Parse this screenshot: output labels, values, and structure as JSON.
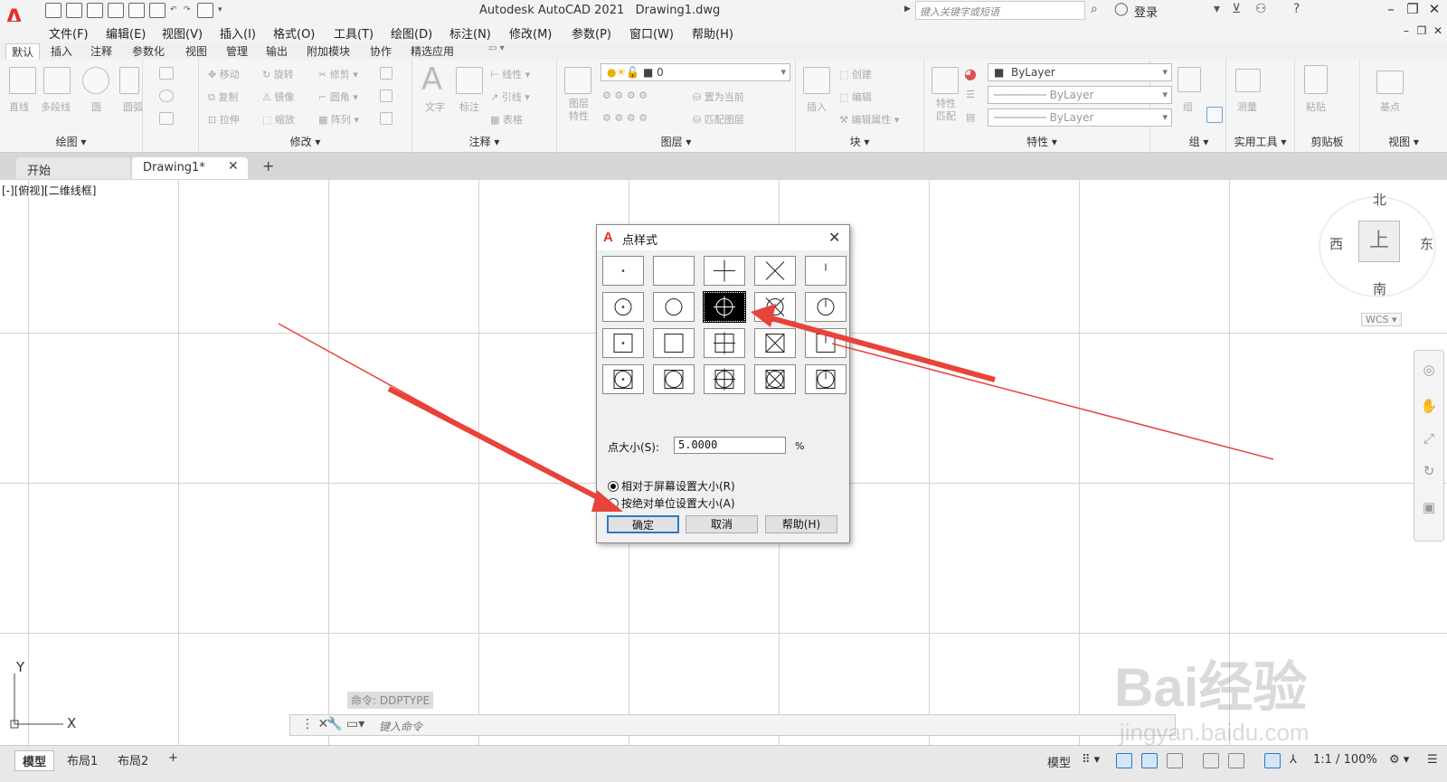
{
  "app": {
    "title": "Autodesk AutoCAD 2021",
    "document": "Drawing1.dwg",
    "logo": "A"
  },
  "search": {
    "placeholder": "键入关键字或短语"
  },
  "user": {
    "login": "登录"
  },
  "menu": [
    "文件(F)",
    "编辑(E)",
    "视图(V)",
    "插入(I)",
    "格式(O)",
    "工具(T)",
    "绘图(D)",
    "标注(N)",
    "修改(M)",
    "参数(P)",
    "窗口(W)",
    "帮助(H)"
  ],
  "ribbon_tabs": [
    "默认",
    "插入",
    "注释",
    "参数化",
    "视图",
    "管理",
    "输出",
    "附加模块",
    "协作",
    "精选应用"
  ],
  "ribbon": {
    "panels": [
      "绘图",
      "修改",
      "注释",
      "图层",
      "块",
      "特性",
      "组",
      "实用工具",
      "剪贴板",
      "视图"
    ],
    "draw_tools": [
      "直线",
      "多段线",
      "圆",
      "圆弧"
    ],
    "modify_tools": [
      "移动",
      "旋转",
      "修剪",
      "复制",
      "镜像",
      "圆角",
      "拉伸",
      "缩放",
      "阵列"
    ],
    "annot_tools": [
      "文字",
      "标注",
      "线性",
      "引线",
      "表格"
    ],
    "layer_tools": [
      "图层特性",
      "置为当前",
      "匹配图层"
    ],
    "layer_value": "0",
    "block_tools": [
      "插入",
      "创建",
      "编辑",
      "编辑属性"
    ],
    "prop_tools": [
      "特性匹配"
    ],
    "bylayer": [
      "ByLayer",
      "ByLayer",
      "ByLayer"
    ],
    "util_tools": [
      "测量"
    ],
    "clip_tools": [
      "粘贴"
    ],
    "group_tools": [
      "组"
    ],
    "view_tools": [
      "基点"
    ]
  },
  "doc_tabs": {
    "start": "开始",
    "current": "Drawing1*"
  },
  "canvas": {
    "view_label": "[-][俯视][二维线框]",
    "viewcube": {
      "north": "北",
      "south": "南",
      "east": "东",
      "west": "西",
      "top": "上",
      "wcs": "WCS"
    },
    "ucs": {
      "x": "X",
      "y": "Y"
    }
  },
  "command": {
    "history": "命令: DDPTYPE",
    "placeholder": "键入命令"
  },
  "layouts": [
    "模型",
    "布局1",
    "布局2"
  ],
  "statusbar": {
    "model": "模型",
    "scale": "1:1 / 100%"
  },
  "dialog": {
    "title": "点样式",
    "size_label": "点大小(S):",
    "size_value": "5.0000",
    "size_unit": "%",
    "radio_relative": "相对于屏幕设置大小(R)",
    "radio_absolute": "按绝对单位设置大小(A)",
    "ok": "确定",
    "cancel": "取消",
    "help": "帮助(H)",
    "selected_style_index": 7
  },
  "annotation_color": "#e8433a",
  "watermark": {
    "brand": "Bai经验",
    "url": "jingyan.baidu.com"
  }
}
